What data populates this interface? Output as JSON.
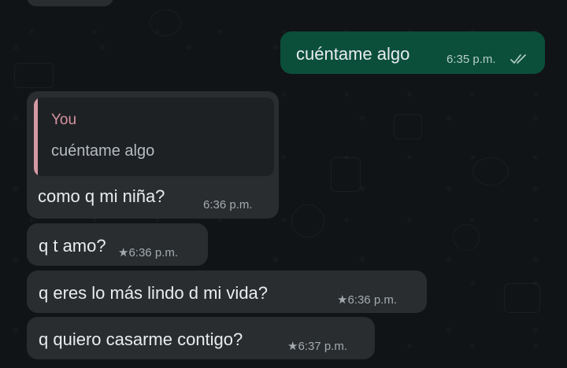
{
  "chat": {
    "messages": [
      {
        "direction": "outgoing",
        "text": "cuéntame algo",
        "time": "6:35 p.m.",
        "status_icon": "double-check-icon"
      },
      {
        "direction": "incoming",
        "reply_to": {
          "author": "You",
          "text": "cuéntame algo"
        },
        "text": "como q mi niña?",
        "time": "6:36 p.m."
      },
      {
        "direction": "incoming",
        "text": "q t amo?",
        "time": "6:36 p.m.",
        "starred": true
      },
      {
        "direction": "incoming",
        "text": "q eres lo más lindo d mi vida?",
        "time": "6:36 p.m.",
        "starred": true
      },
      {
        "direction": "incoming",
        "text": "q quiero casarme contigo?",
        "time": "6:37 p.m.",
        "starred": true
      }
    ]
  },
  "icons": {
    "star": "★",
    "star_name": "star-icon"
  },
  "colors": {
    "background": "#111416",
    "incoming_bubble": "#2a2d30",
    "outgoing_bubble": "#0b4f3b",
    "quote_accent": "#d6949f"
  }
}
